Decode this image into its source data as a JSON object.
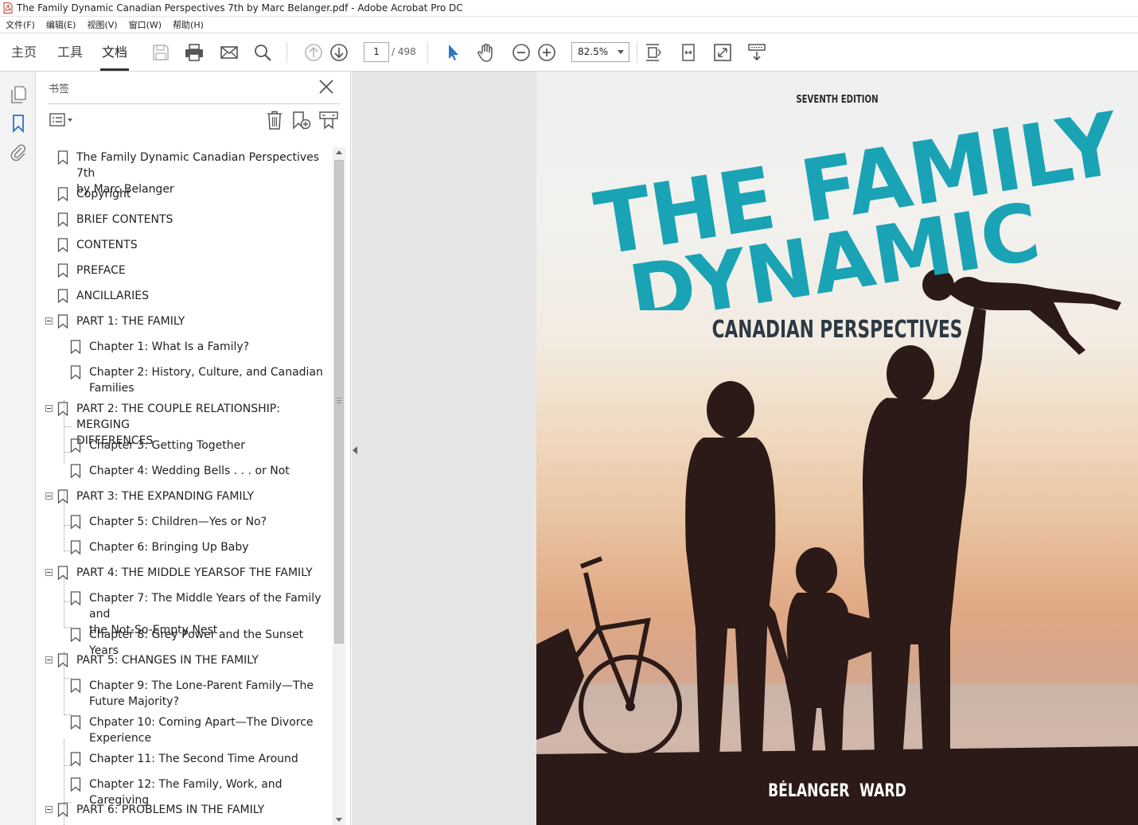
{
  "window": {
    "title": "The Family Dynamic Canadian Perspectives 7th by Marc Belanger.pdf - Adobe Acrobat Pro DC"
  },
  "menu": [
    "文件(F)",
    "编辑(E)",
    "视图(V)",
    "窗口(W)",
    "帮助(H)"
  ],
  "toolbar": {
    "tabs": [
      "主页",
      "工具",
      "文档"
    ],
    "active_tab": "文档",
    "page_current": "1",
    "page_total": "/ 498",
    "zoom": "82.5%"
  },
  "panel": {
    "title": "书签",
    "bookmarks": [
      {
        "label": "The Family Dynamic Canadian Perspectives 7th",
        "label2": "by Marc Belanger"
      },
      {
        "label": "Copyright"
      },
      {
        "label": "BRIEF CONTENTS"
      },
      {
        "label": "CONTENTS"
      },
      {
        "label": "PREFACE"
      },
      {
        "label": "ANCILLARIES"
      },
      {
        "label": "PART 1: THE FAMILY"
      },
      {
        "label": "Chapter 1: What Is a Family?"
      },
      {
        "label": "Chapter 2: History, Culture, and Canadian",
        "label2": "Families"
      },
      {
        "label": "PART 2: THE COUPLE RELATIONSHIP: MERGING",
        "label2": "DIFFERENCES"
      },
      {
        "label": "Chapter 3: Getting Together"
      },
      {
        "label": "Chapter 4: Wedding Bells . . . or Not"
      },
      {
        "label": "PART 3: THE EXPANDING FAMILY"
      },
      {
        "label": "Chapter 5: Children—Yes or No?"
      },
      {
        "label": "Chapter 6: Bringing Up Baby"
      },
      {
        "label": "PART 4: THE MIDDLE YEARSOF THE FAMILY"
      },
      {
        "label": "Chapter 7: The Middle Years of the Family and",
        "label2": "the Not-So-Empty Nest"
      },
      {
        "label": "Chapter 8: Grey Power and the Sunset Years"
      },
      {
        "label": "PART 5: CHANGES IN THE FAMILY"
      },
      {
        "label": "Chapter 9: The Lone-Parent Family—The",
        "label2": "Future Majority?"
      },
      {
        "label": "Chpater 10: Coming Apart—The Divorce",
        "label2": "Experience"
      },
      {
        "label": "Chapter 11: The Second Time Around"
      },
      {
        "label": "Chapter 12: The Family, Work, and Caregiving"
      },
      {
        "label": "PART 6: PROBLEMS IN THE FAMILY"
      }
    ]
  },
  "cover": {
    "edition": "SEVENTH EDITION",
    "title_line1": "THE FAMILY",
    "title_line2": "DYNAMIC",
    "subtitle": "CANADIAN PERSPECTIVES",
    "author1": "BÉLANGER",
    "author2": "WARD",
    "title_color": "#1aa3b5"
  }
}
